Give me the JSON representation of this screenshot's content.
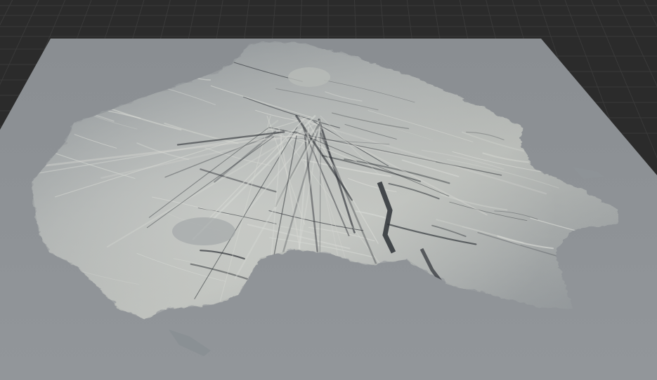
{
  "viewport": {
    "background_color": "#2b2b2b",
    "grid_line_color": "#3a3a3a",
    "plane_color": "#8e9296",
    "terrain_light_color": "#d7d9d4",
    "terrain_mid_color": "#9ea2a4",
    "terrain_shadow_color": "#2d3136"
  },
  "scene": {
    "objects": [
      {
        "icon": "terrain-mesh-icon"
      },
      {
        "icon": "ground-plane-icon"
      },
      {
        "icon": "grid-floor-icon"
      }
    ]
  }
}
